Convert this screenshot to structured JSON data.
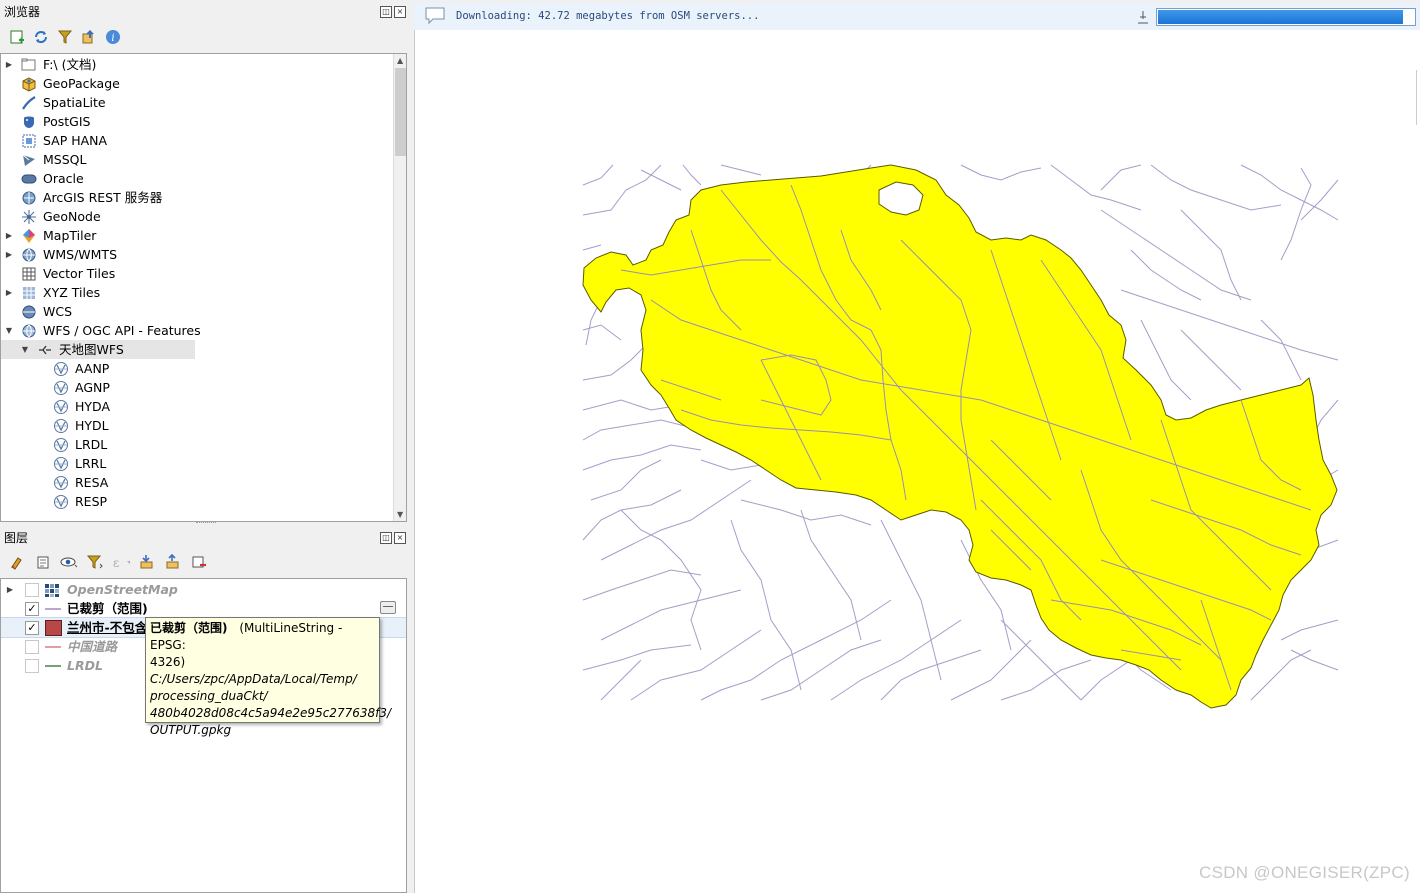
{
  "browser_panel": {
    "title": "浏览器",
    "toolbar_icons": [
      "add-icon",
      "refresh-icon",
      "filter-icon",
      "collapse-icon",
      "info-icon"
    ],
    "items": [
      {
        "label": "F:\\ (文档)",
        "icon": "folder-icon",
        "expandable": true,
        "indent": 0
      },
      {
        "label": "GeoPackage",
        "icon": "geopackage-icon",
        "expandable": false,
        "indent": 0
      },
      {
        "label": "SpatiaLite",
        "icon": "spatialite-icon",
        "expandable": false,
        "indent": 0
      },
      {
        "label": "PostGIS",
        "icon": "postgis-icon",
        "expandable": false,
        "indent": 0
      },
      {
        "label": "SAP HANA",
        "icon": "saphana-icon",
        "expandable": false,
        "indent": 0
      },
      {
        "label": "MSSQL",
        "icon": "mssql-icon",
        "expandable": false,
        "indent": 0
      },
      {
        "label": "Oracle",
        "icon": "oracle-icon",
        "expandable": false,
        "indent": 0
      },
      {
        "label": "ArcGIS REST 服务器",
        "icon": "arcgis-icon",
        "expandable": false,
        "indent": 0
      },
      {
        "label": "GeoNode",
        "icon": "geonode-icon",
        "expandable": false,
        "indent": 0
      },
      {
        "label": "MapTiler",
        "icon": "maptiler-icon",
        "expandable": true,
        "indent": 0
      },
      {
        "label": "WMS/WMTS",
        "icon": "wms-icon",
        "expandable": true,
        "indent": 0
      },
      {
        "label": "Vector Tiles",
        "icon": "vectortiles-icon",
        "expandable": false,
        "indent": 0
      },
      {
        "label": "XYZ Tiles",
        "icon": "xyz-icon",
        "expandable": true,
        "indent": 0
      },
      {
        "label": "WCS",
        "icon": "wcs-icon",
        "expandable": false,
        "indent": 0
      },
      {
        "label": "WFS / OGC API - Features",
        "icon": "wfs-icon",
        "expandable": true,
        "expanded": true,
        "indent": 0
      },
      {
        "label": "天地图WFS",
        "icon": "connection-icon",
        "expandable": true,
        "expanded": true,
        "indent": 1,
        "selected": true
      },
      {
        "label": "AANP",
        "icon": "wfs-layer-icon",
        "expandable": false,
        "indent": 2
      },
      {
        "label": "AGNP",
        "icon": "wfs-layer-icon",
        "expandable": false,
        "indent": 2
      },
      {
        "label": "HYDA",
        "icon": "wfs-layer-icon",
        "expandable": false,
        "indent": 2
      },
      {
        "label": "HYDL",
        "icon": "wfs-layer-icon",
        "expandable": false,
        "indent": 2
      },
      {
        "label": "LRDL",
        "icon": "wfs-layer-icon",
        "expandable": false,
        "indent": 2
      },
      {
        "label": "LRRL",
        "icon": "wfs-layer-icon",
        "expandable": false,
        "indent": 2
      },
      {
        "label": "RESA",
        "icon": "wfs-layer-icon",
        "expandable": false,
        "indent": 2
      },
      {
        "label": "RESP",
        "icon": "wfs-layer-icon",
        "expandable": false,
        "indent": 2
      }
    ]
  },
  "layers_panel": {
    "title": "图层",
    "toolbar_icons": [
      "style-icon",
      "add-group-icon",
      "visibility-icon",
      "filter-legend-icon",
      "expression-filter-icon",
      "expand-all-icon",
      "collapse-all-icon",
      "remove-layer-icon"
    ],
    "layers": [
      {
        "name": "OpenStreetMap",
        "checked": false,
        "symbol": "raster",
        "italic": true,
        "bold": true,
        "dim": true,
        "expandable": true
      },
      {
        "name": "已裁剪（范围)",
        "checked": true,
        "symbol": "line",
        "color": "#b8a8cf",
        "bold": true,
        "dim": false,
        "expandable": false
      },
      {
        "name": "兰州市-不包含",
        "checked": true,
        "symbol": "fill",
        "color": "#b84848",
        "bold": true,
        "underline": true,
        "dim": false,
        "expandable": false,
        "selected": true
      },
      {
        "name": "中国道路",
        "checked": false,
        "symbol": "line",
        "color": "#e0a0a0",
        "italic": true,
        "bold": true,
        "dim": true,
        "expandable": false
      },
      {
        "name": "LRDL",
        "checked": false,
        "symbol": "line",
        "color": "#78a078",
        "italic": true,
        "bold": true,
        "dim": true,
        "expandable": false
      }
    ]
  },
  "message_bar": {
    "text": "Downloading: 42.72 megabytes from OSM servers...",
    "progress_fraction": 0.95
  },
  "tooltip": {
    "title": "已裁剪（范围)",
    "type_text": "(MultiLineString - EPSG:",
    "crs_tail": "4326)",
    "path_lines": [
      "C:/Users/zpc/AppData/Local/Temp/",
      "processing_duaCkt/",
      "480b4028d08c4c5a94e2e95c277638f3/",
      "OUTPUT.gpkg"
    ]
  },
  "watermark": "CSDN @ONEGISER(ZPC)",
  "colors": {
    "fill": "#ffff00",
    "roads": "#a89cc8",
    "inner_roads": "#9a8fb5",
    "progress": "#1e7fdc"
  }
}
